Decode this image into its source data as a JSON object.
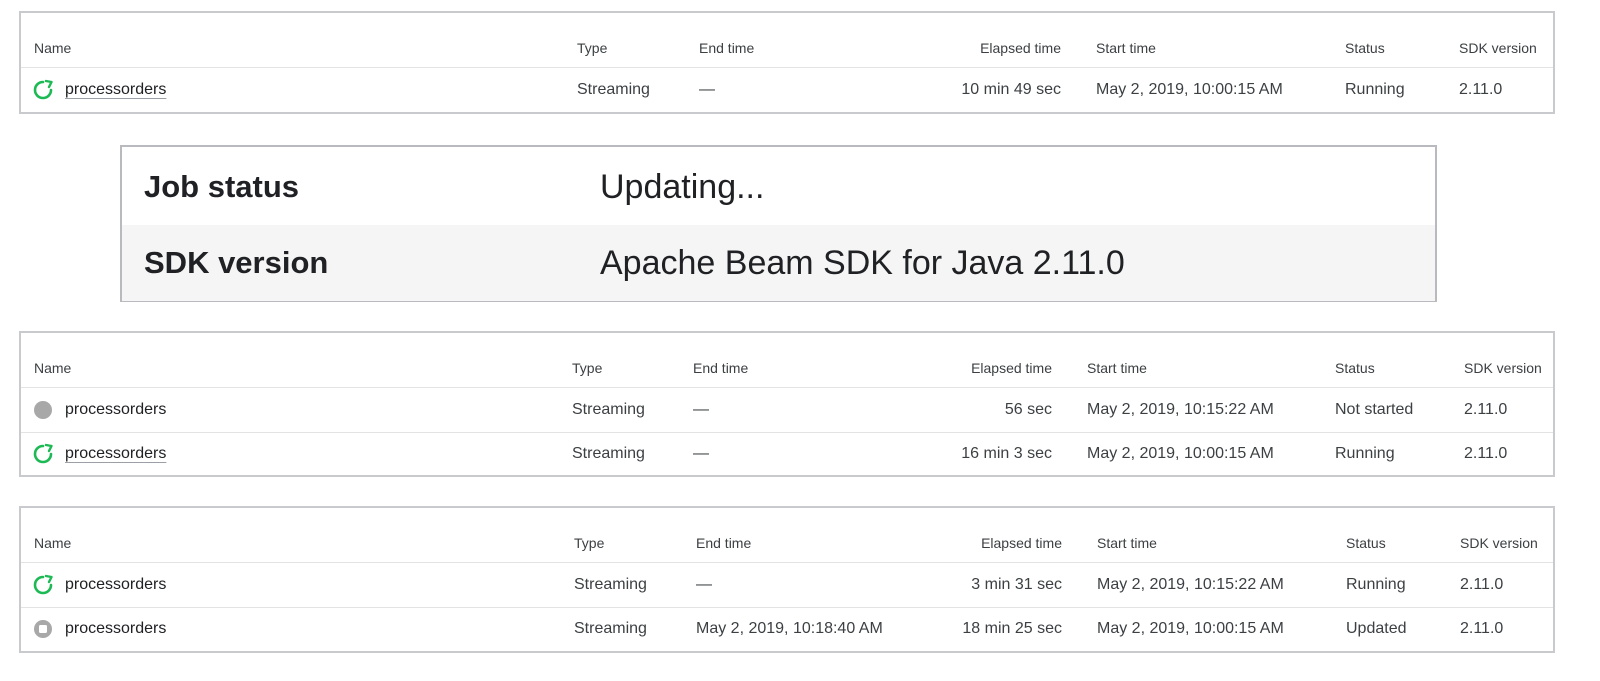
{
  "colors": {
    "running": "#1db954",
    "not_started": "#a8a8a8",
    "updated": "#a8a8a8"
  },
  "table1": {
    "headers": [
      "Name",
      "Type",
      "End time",
      "Elapsed time",
      "Start time",
      "Status",
      "SDK version"
    ],
    "rows": [
      {
        "icon": "running-icon",
        "name": "processorders",
        "type": "Streaming",
        "end_time": "—",
        "elapsed": "10 min 49 sec",
        "start": "May 2, 2019, 10:00:15 AM",
        "status": "Running",
        "sdk": "2.11.0"
      }
    ]
  },
  "info_panel": {
    "job_status_label": "Job status",
    "job_status_value": "Updating...",
    "sdk_version_label": "SDK version",
    "sdk_version_value": "Apache Beam SDK for Java 2.11.0"
  },
  "table2": {
    "headers": [
      "Name",
      "Type",
      "End time",
      "Elapsed time",
      "Start time",
      "Status",
      "SDK version"
    ],
    "rows": [
      {
        "icon": "not-started-icon",
        "name": "processorders",
        "type": "Streaming",
        "end_time": "—",
        "elapsed": "56 sec",
        "start": "May 2, 2019, 10:15:22 AM",
        "status": "Not started",
        "sdk": "2.11.0"
      },
      {
        "icon": "running-icon",
        "name": "processorders",
        "type": "Streaming",
        "end_time": "—",
        "elapsed": "16 min 3 sec",
        "start": "May 2, 2019, 10:00:15 AM",
        "status": "Running",
        "sdk": "2.11.0"
      }
    ]
  },
  "table3": {
    "headers": [
      "Name",
      "Type",
      "End time",
      "Elapsed time",
      "Start time",
      "Status",
      "SDK version"
    ],
    "rows": [
      {
        "icon": "running-icon",
        "name": "processorders",
        "type": "Streaming",
        "end_time": "—",
        "elapsed": "3 min 31 sec",
        "start": "May 2, 2019, 10:15:22 AM",
        "status": "Running",
        "sdk": "2.11.0"
      },
      {
        "icon": "updated-icon",
        "name": "processorders",
        "type": "Streaming",
        "end_time": "May 2, 2019, 10:18:40 AM",
        "elapsed": "18 min 25 sec",
        "start": "May 2, 2019, 10:00:15 AM",
        "status": "Updated",
        "sdk": "2.11.0"
      }
    ]
  }
}
